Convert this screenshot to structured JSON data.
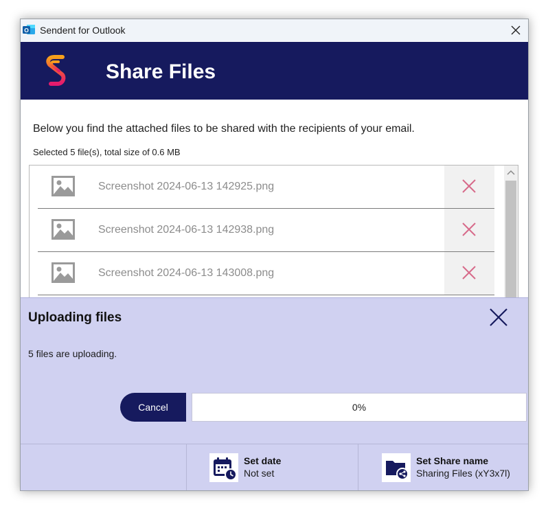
{
  "window": {
    "title": "Sendent for Outlook",
    "app_icon": "outlook-icon"
  },
  "banner": {
    "title": "Share Files",
    "logo": "sendent-logo"
  },
  "content": {
    "intro": "Below you find the attached files to be shared with the recipients of your email.",
    "summary": "Selected 5 file(s), total size of 0.6 MB"
  },
  "files": [
    {
      "name": "Screenshot 2024-06-13 142925.png",
      "icon": "image-file-icon"
    },
    {
      "name": "Screenshot 2024-06-13 142938.png",
      "icon": "image-file-icon"
    },
    {
      "name": "Screenshot 2024-06-13 143008.png",
      "icon": "image-file-icon"
    }
  ],
  "upload": {
    "title": "Uploading files",
    "status": "5 files are uploading.",
    "cancel_label": "Cancel",
    "progress": 0,
    "progress_text": "0%"
  },
  "footer": {
    "set_date": {
      "label": "Set date",
      "value": "Not set",
      "icon": "calendar-clock-icon"
    },
    "set_share_name": {
      "label": "Set Share name",
      "value": "Sharing Files (xY3x7l)",
      "icon": "folder-share-icon"
    }
  },
  "colors": {
    "banner": "#161a5e",
    "overlay": "#d0d1f1",
    "remove_icon": "#d76a8a",
    "accent": "#161a5e"
  }
}
